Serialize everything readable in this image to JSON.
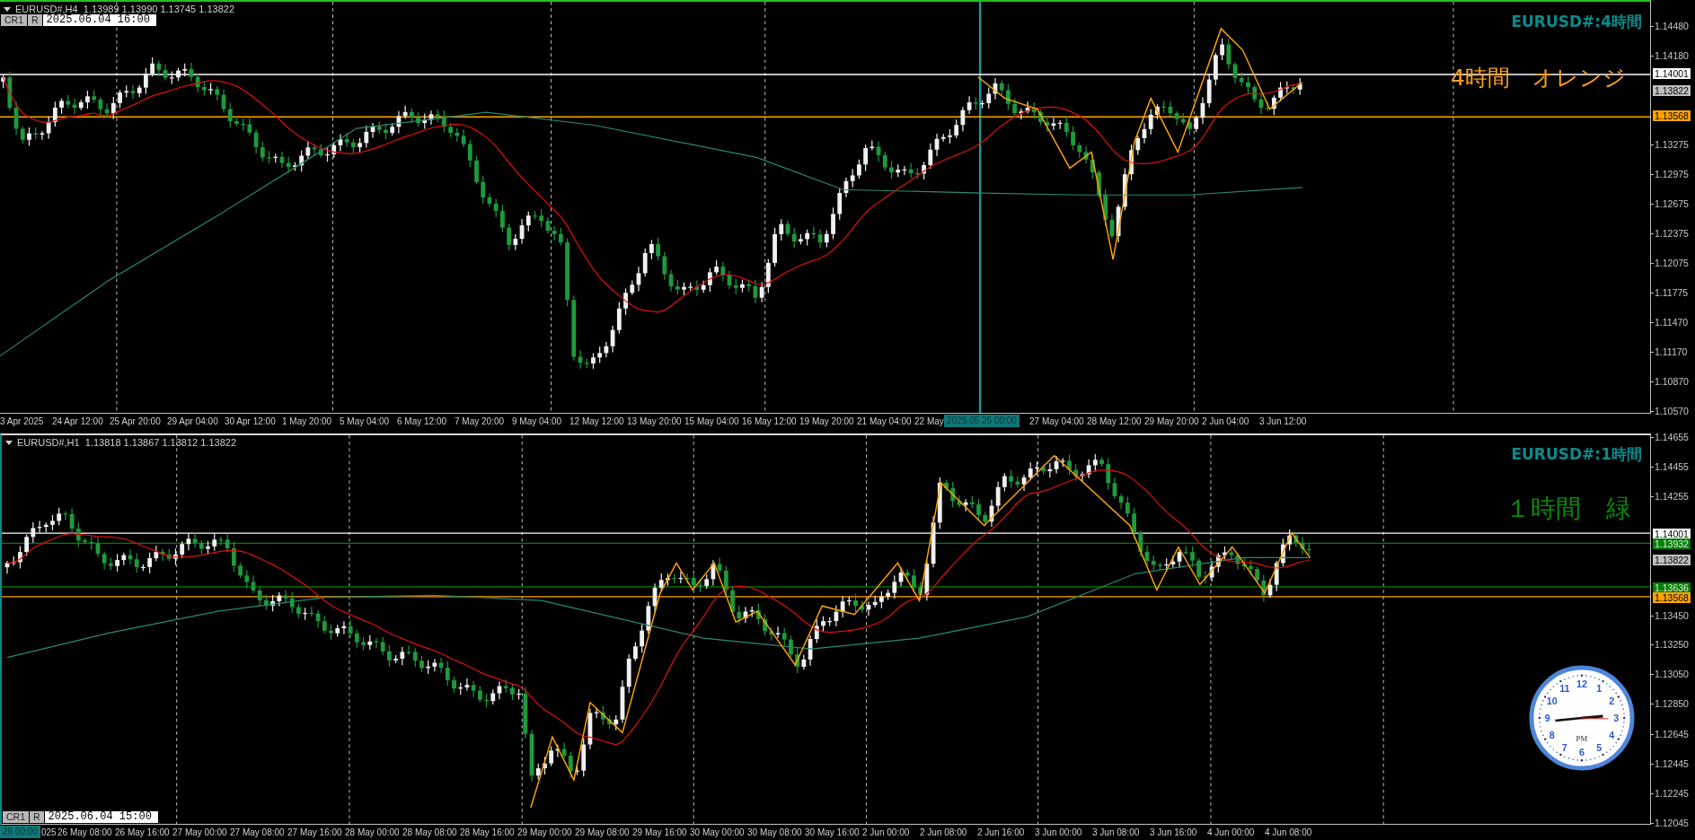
{
  "panels": [
    {
      "header": "EURUSD#,H4  1.13989 1.13990 1.13745 1.13822",
      "title": "EURUSD#:4時間",
      "note": "4時間　オレンジ",
      "color": "#ffa020",
      "toolbar": {
        "buttons": [
          "CR1",
          "R"
        ],
        "time": "2025.06.04 16:00"
      },
      "price_ticks": [
        "1.14480",
        "1.14180",
        "1.13275",
        "1.12975",
        "1.12675",
        "1.12375",
        "1.12075",
        "1.11775",
        "1.11470",
        "1.11170",
        "1.10870",
        "1.10570"
      ],
      "price_tags": [
        {
          "text": "1.14001",
          "kind": "level",
          "color": "#ffffff"
        },
        {
          "text": "1.13822",
          "kind": "current",
          "color": "#c0c0c0"
        },
        {
          "text": "1.13568",
          "kind": "level",
          "color": "#ffa500"
        }
      ],
      "time_labels": [
        "3 Apr 2025",
        "24 Apr 12:00",
        "25 Apr 20:00",
        "29 Apr 04:00",
        "30 Apr 12:00",
        "1 May 20:00",
        "5 May 04:00",
        "6 May 12:00",
        "7 May 20:00",
        "9 May 04:00",
        "12 May 12:00",
        "13 May 20:00",
        "15 May 04:00",
        "16 May 12:00",
        "19 May 20:00",
        "21 May 04:00",
        "22 May",
        "2025.05.26 00:00",
        "27 May 04:00",
        "28 May 12:00",
        "29 May 20:00",
        "2 Jun 04:00",
        "3 Jun 12:00"
      ]
    },
    {
      "header": "EURUSD#,H1  1.13818 1.13867 1.13812 1.13822",
      "title": "EURUSD#:1時間",
      "note": "１時間　緑",
      "color": "#0a8a0a",
      "toolbar": {
        "buttons": [
          "CR1",
          "R"
        ],
        "time": "2025.06.04 15:00"
      },
      "price_ticks": [
        "1.14655",
        "1.14455",
        "1.14255",
        "1.13450",
        "1.13250",
        "1.13050",
        "1.12850",
        "1.12645",
        "1.12445",
        "1.12245",
        "1.12045"
      ],
      "price_tags": [
        {
          "text": "1.14001",
          "kind": "level",
          "color": "#ffffff"
        },
        {
          "text": "1.13932",
          "kind": "level",
          "color": "#008000"
        },
        {
          "text": "1.13822",
          "kind": "current",
          "color": "#c0c0c0"
        },
        {
          "text": "1.13636",
          "kind": "level",
          "color": "#008000"
        },
        {
          "text": "1.13568",
          "kind": "level",
          "color": "#ffa500"
        }
      ],
      "time_labels": [
        "26 00:00",
        "025",
        "26 May 08:00",
        "26 May 16:00",
        "27 May 00:00",
        "27 May 08:00",
        "27 May 16:00",
        "28 May 00:00",
        "28 May 08:00",
        "28 May 16:00",
        "29 May 00:00",
        "29 May 08:00",
        "29 May 16:00",
        "30 May 00:00",
        "30 May 08:00",
        "30 May 16:00",
        "2 Jun 00:00",
        "2 Jun 08:00",
        "2 Jun 16:00",
        "3 Jun 00:00",
        "3 Jun 08:00",
        "3 Jun 16:00",
        "4 Jun 00:00",
        "4 Jun 08:00"
      ]
    }
  ],
  "clock": {
    "numerals": [
      "12",
      "11",
      "1",
      "10",
      "2",
      "9",
      "3",
      "8",
      "4",
      "7",
      "5",
      "6"
    ],
    "meridiem": "PM"
  }
}
